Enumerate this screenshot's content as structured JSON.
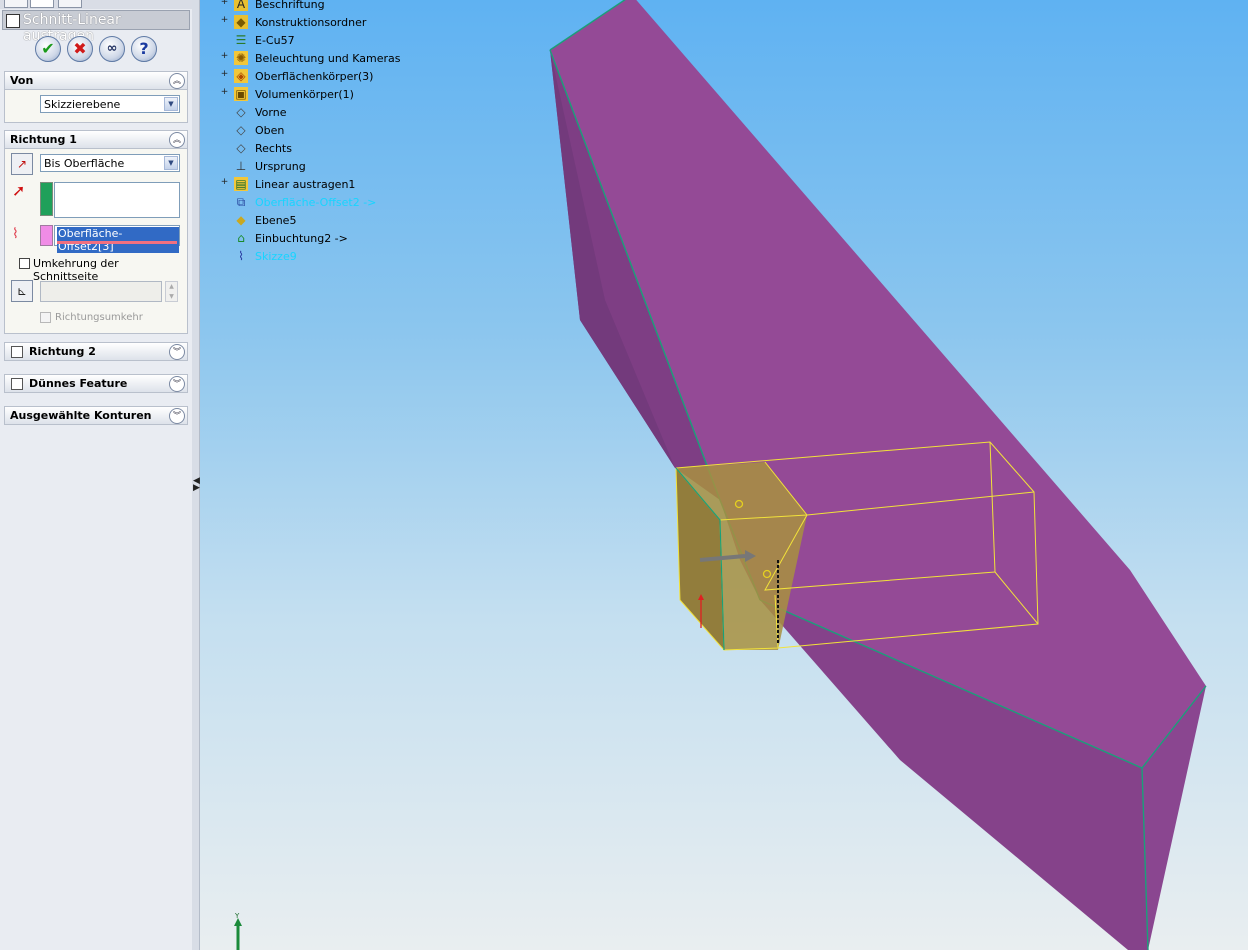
{
  "property_manager": {
    "title": "Schnitt-Linear austragen",
    "buttons": {
      "ok_icon": "ok-check-icon",
      "cancel_icon": "cancel-x-icon",
      "preview_icon": "preview-glasses-icon",
      "help_icon": "help-question-icon"
    },
    "von": {
      "header": "Von",
      "start_condition": "Skizzierebene"
    },
    "richtung1": {
      "header": "Richtung 1",
      "end_condition": "Bis Oberfläche",
      "selected_face": "Oberfläche-Offset2[3]",
      "flip_side_label": "Umkehrung der Schnittseite",
      "flip_side_checked": false,
      "draft_value": "",
      "draft_outward_label": "Richtungsumkehr",
      "face_color": "#f08ce6",
      "direction_color": "#1fa05a"
    },
    "richtung2": {
      "header": "Richtung 2",
      "checked": false
    },
    "thin_feature": {
      "header": "Dünnes Feature",
      "checked": false
    },
    "selected_contours": {
      "header": "Ausgewählte Konturen"
    }
  },
  "feature_tree": {
    "items": [
      {
        "label": "Beschriftung",
        "icon": "annotation-icon",
        "expandable": true,
        "highlight": false
      },
      {
        "label": "Konstruktionsordner",
        "icon": "design-binder-icon",
        "expandable": true,
        "highlight": false
      },
      {
        "label": "E-Cu57",
        "icon": "material-icon",
        "expandable": false,
        "highlight": false
      },
      {
        "label": "Beleuchtung und Kameras",
        "icon": "lights-cameras-icon",
        "expandable": true,
        "highlight": false
      },
      {
        "label": "Oberflächenkörper(3)",
        "icon": "surface-bodies-icon",
        "expandable": true,
        "highlight": false
      },
      {
        "label": "Volumenkörper(1)",
        "icon": "solid-bodies-icon",
        "expandable": true,
        "highlight": false
      },
      {
        "label": "Vorne",
        "icon": "plane-icon",
        "expandable": false,
        "highlight": false
      },
      {
        "label": "Oben",
        "icon": "plane-icon",
        "expandable": false,
        "highlight": false
      },
      {
        "label": "Rechts",
        "icon": "plane-icon",
        "expandable": false,
        "highlight": false
      },
      {
        "label": "Ursprung",
        "icon": "origin-icon",
        "expandable": false,
        "highlight": false
      },
      {
        "label": "Linear austragen1",
        "icon": "extrude-icon",
        "expandable": true,
        "highlight": false
      },
      {
        "label": "Oberfläche-Offset2 ->",
        "icon": "offset-surface-icon",
        "expandable": false,
        "highlight": true
      },
      {
        "label": "Ebene5",
        "icon": "plane-yellow-icon",
        "expandable": false,
        "highlight": false
      },
      {
        "label": "Einbuchtung2 ->",
        "icon": "indent-icon",
        "expandable": false,
        "highlight": false
      },
      {
        "label": "Skizze9",
        "icon": "sketch-icon",
        "expandable": false,
        "highlight": true
      }
    ]
  },
  "viewport": {
    "background_top": "#5fb2f2",
    "background_bottom": "#e9eef0",
    "body_color": "#944a96",
    "preview_color": "#a89040",
    "edge_color": "#1aa07a",
    "preview_edge_color": "#f2e23a",
    "triad_label": "Y"
  }
}
